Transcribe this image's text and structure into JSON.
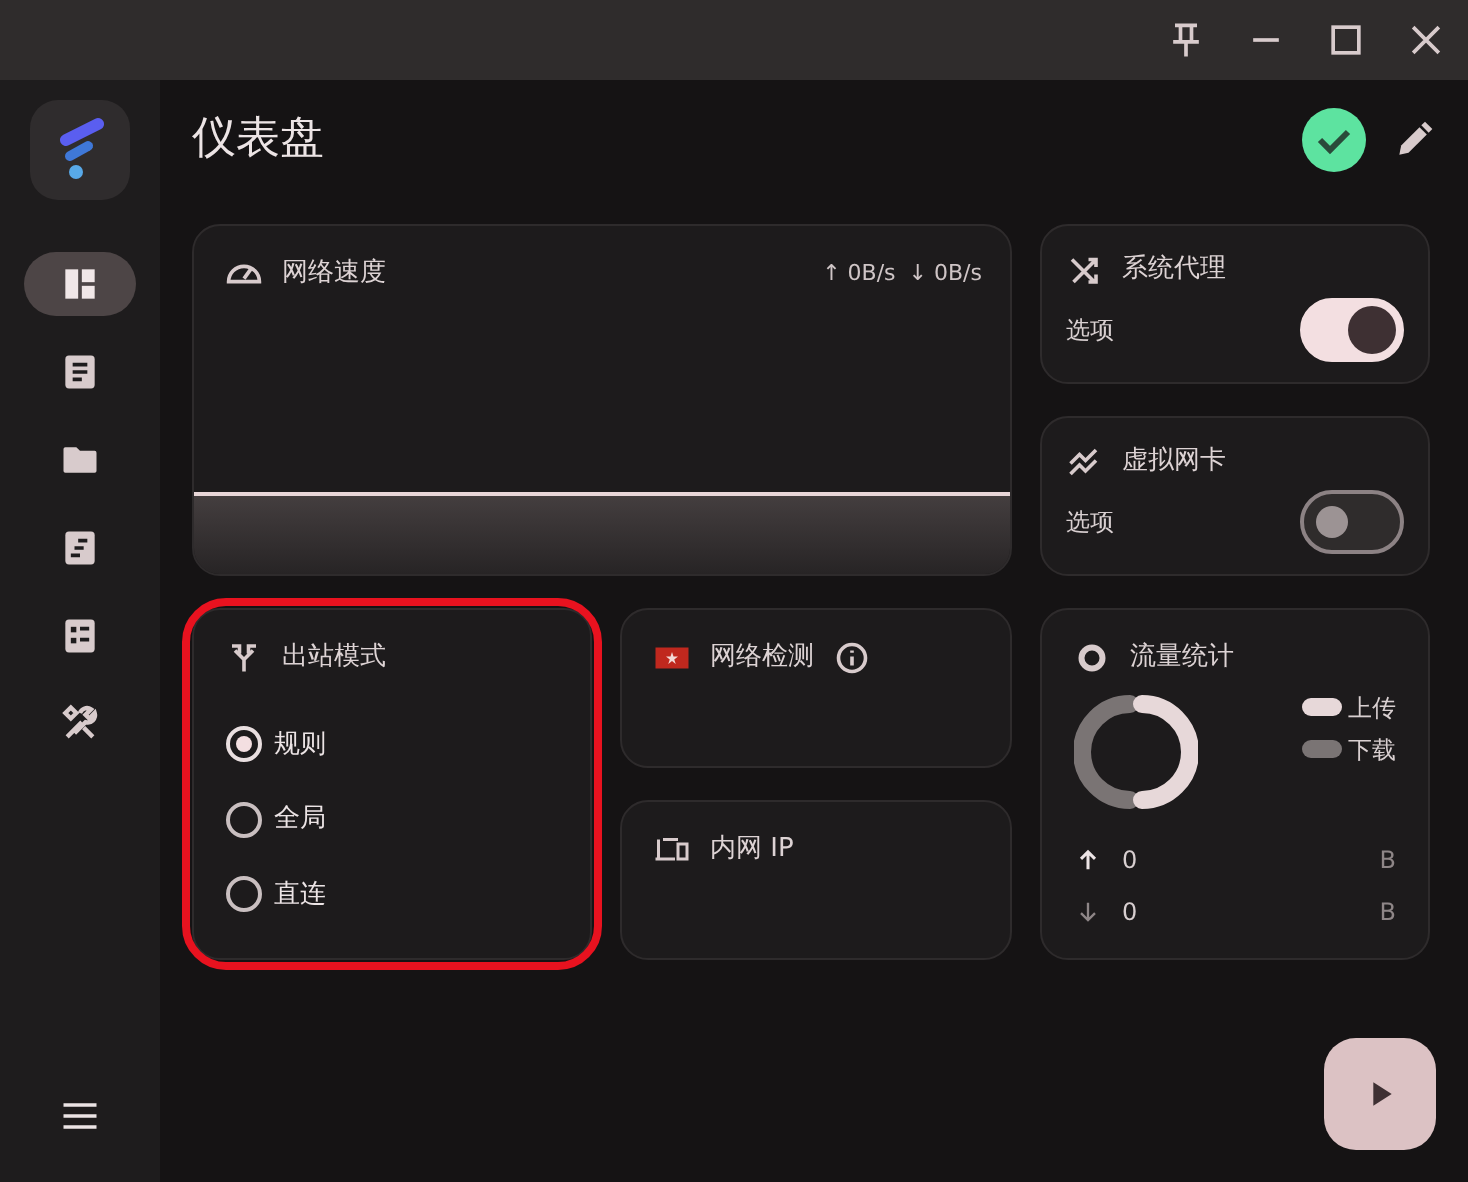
{
  "sidebar": {
    "items": [
      {
        "kind": "dashboard",
        "selected": true
      },
      {
        "kind": "document",
        "selected": false
      },
      {
        "kind": "folder",
        "selected": false
      },
      {
        "kind": "rules",
        "selected": false
      },
      {
        "kind": "list",
        "selected": false
      },
      {
        "kind": "tools",
        "selected": false
      }
    ]
  },
  "header": {
    "title": "仪表盘"
  },
  "speed": {
    "title": "网络速度",
    "upload": "↑ 0B/s",
    "download": "↓ 0B/s"
  },
  "proxy": {
    "title": "系统代理",
    "label": "选项",
    "on": true
  },
  "tun": {
    "title": "虚拟网卡",
    "label": "选项",
    "on": false
  },
  "outbound": {
    "title": "出站模式",
    "highlighted": true,
    "options": [
      {
        "label": "规则",
        "selected": true
      },
      {
        "label": "全局",
        "selected": false
      },
      {
        "label": "直连",
        "selected": false
      }
    ]
  },
  "check": {
    "title": "网络检测"
  },
  "ip": {
    "title": "内网 IP"
  },
  "traffic": {
    "title": "流量统计",
    "legend": [
      {
        "label": "上传",
        "color": "#e7d8d9"
      },
      {
        "label": "下载",
        "color": "#7a7474"
      }
    ],
    "rows": [
      {
        "kind": "upload",
        "value": "0",
        "unit": "B"
      },
      {
        "kind": "download",
        "value": "0",
        "unit": "B"
      }
    ]
  }
}
